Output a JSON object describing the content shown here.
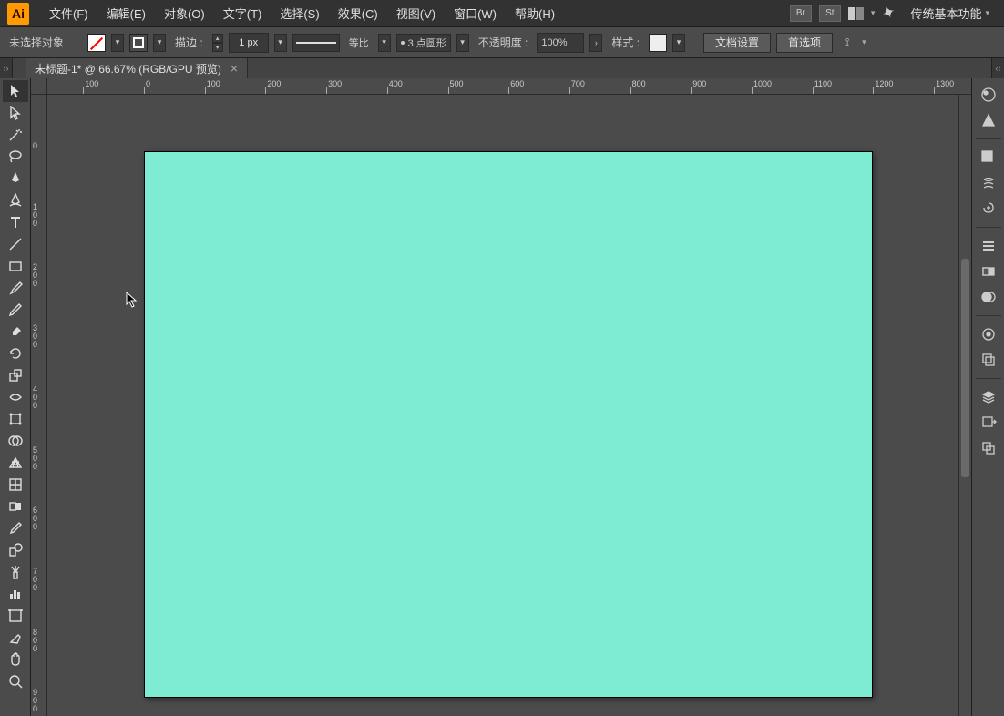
{
  "app": {
    "logo_text": "Ai"
  },
  "menus": [
    "文件(F)",
    "编辑(E)",
    "对象(O)",
    "文字(T)",
    "选择(S)",
    "效果(C)",
    "视图(V)",
    "窗口(W)",
    "帮助(H)"
  ],
  "menubar_icons": {
    "br": "Br",
    "st": "St"
  },
  "workspace": "传统基本功能",
  "control": {
    "selection_status": "未选择对象",
    "stroke_label": "描边 :",
    "stroke_weight": "1 px",
    "stroke_ratio_label": "等比",
    "brush_label": "3 点圆形",
    "opacity_label": "不透明度 :",
    "opacity_value": "100%",
    "style_label": "样式 :",
    "doc_setup_btn": "文档设置",
    "prefs_btn": "首选项"
  },
  "tab": {
    "title": "未标题-1* @ 66.67% (RGB/GPU 预览)",
    "close": "×"
  },
  "ruler_h": [
    "100",
    "0",
    "100",
    "200",
    "300",
    "400",
    "500",
    "600",
    "700",
    "800",
    "900",
    "1000",
    "1100",
    "1200",
    "1300"
  ],
  "ruler_v": [
    "0",
    "100",
    "200",
    "300",
    "400",
    "500",
    "600",
    "700",
    "800",
    "900"
  ],
  "artboard_color": "#7eecd3"
}
